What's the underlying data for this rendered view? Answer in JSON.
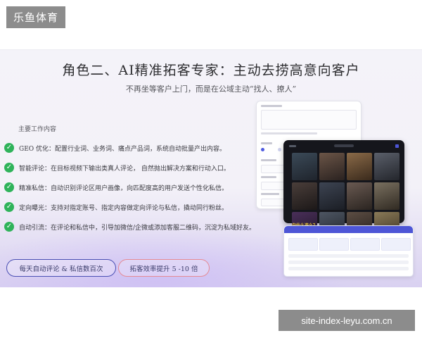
{
  "brand": {
    "name": "乐鱼体育"
  },
  "slide": {
    "title": "角色二、AI精准拓客专家：主动去捞高意向客户",
    "subtitle": "不再坐等客户上门，而是在公域主动“找人、撩人”",
    "section_heading": "主要工作内容",
    "features": [
      {
        "icon": "check-circle-icon",
        "text": "GEO 优化：配置行业词、业务词、痛点产品词，系统自动批量产出内容。"
      },
      {
        "icon": "check-circle-icon",
        "text": "智能评论：在目标视频下输出类真人评论， 自然抛出解决方案和行动入口。"
      },
      {
        "icon": "check-circle-icon",
        "text": "精准私信：自动识别评论区用户画像，向匹配度高的用户发送个性化私信。"
      },
      {
        "icon": "check-circle-icon",
        "text": "定向曝光：支持对指定账号、指定内容做定向评论与私信，撬动同行粉丝。"
      },
      {
        "icon": "check-circle-icon",
        "text": "自动引流：在评论和私信中，引导加微信/企微或添加客服二维码，沉淀为私域好友。"
      }
    ],
    "highlights": [
      {
        "label": "每天自动评论 & 私信数百次",
        "border_color": "#4a4fb4"
      },
      {
        "label": "拓客效率提升 5 -10 倍",
        "border_color": "#e58a95"
      }
    ]
  },
  "mockups": {
    "thumbnail_captions": [
      "向什么选么？"
    ],
    "accent_color": "#4d55d6"
  },
  "watermark": {
    "text": "site-index-leyu.com.cn"
  }
}
